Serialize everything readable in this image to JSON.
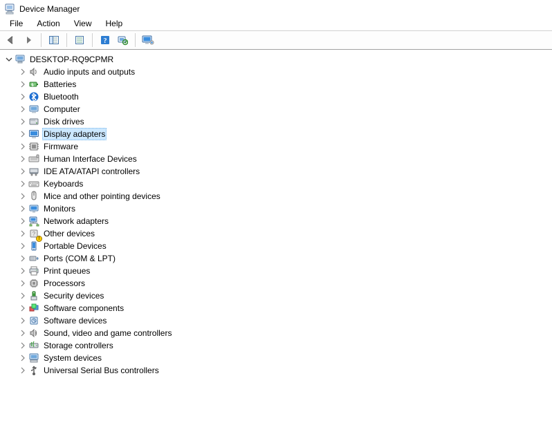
{
  "window": {
    "title": "Device Manager"
  },
  "menu": {
    "items": [
      {
        "label": "File"
      },
      {
        "label": "Action"
      },
      {
        "label": "View"
      },
      {
        "label": "Help"
      }
    ]
  },
  "toolbar": {
    "buttons": [
      {
        "id": "back",
        "name": "back-button",
        "icon": "arrow-left-icon"
      },
      {
        "id": "forward",
        "name": "forward-button",
        "icon": "arrow-right-icon"
      },
      {
        "sep": true
      },
      {
        "id": "console",
        "name": "show-hide-console-tree-button",
        "icon": "console-tree-icon"
      },
      {
        "sep": true
      },
      {
        "id": "props",
        "name": "properties-button",
        "icon": "properties-icon"
      },
      {
        "sep": true
      },
      {
        "id": "help",
        "name": "help-button",
        "icon": "help-icon"
      },
      {
        "id": "scan",
        "name": "scan-hardware-button",
        "icon": "scan-icon"
      },
      {
        "sep": true
      },
      {
        "id": "monitor",
        "name": "devices-button",
        "icon": "monitor-icon"
      }
    ]
  },
  "tree": {
    "root": {
      "label": "DESKTOP-RQ9CPMR",
      "expanded": true,
      "icon": "computer-icon"
    },
    "categories": [
      {
        "label": "Audio inputs and outputs",
        "icon": "speaker-icon"
      },
      {
        "label": "Batteries",
        "icon": "battery-icon"
      },
      {
        "label": "Bluetooth",
        "icon": "bluetooth-icon"
      },
      {
        "label": "Computer",
        "icon": "computer-small-icon"
      },
      {
        "label": "Disk drives",
        "icon": "disk-icon"
      },
      {
        "label": "Display adapters",
        "icon": "display-icon",
        "selected": true
      },
      {
        "label": "Firmware",
        "icon": "firmware-icon"
      },
      {
        "label": "Human Interface Devices",
        "icon": "hid-icon"
      },
      {
        "label": "IDE ATA/ATAPI controllers",
        "icon": "ide-icon"
      },
      {
        "label": "Keyboards",
        "icon": "keyboard-icon"
      },
      {
        "label": "Mice and other pointing devices",
        "icon": "mouse-icon"
      },
      {
        "label": "Monitors",
        "icon": "monitor-small-icon"
      },
      {
        "label": "Network adapters",
        "icon": "network-icon"
      },
      {
        "label": "Other devices",
        "icon": "other-icon",
        "warn": true
      },
      {
        "label": "Portable Devices",
        "icon": "portable-icon"
      },
      {
        "label": "Ports (COM & LPT)",
        "icon": "port-icon"
      },
      {
        "label": "Print queues",
        "icon": "printer-icon"
      },
      {
        "label": "Processors",
        "icon": "cpu-icon"
      },
      {
        "label": "Security devices",
        "icon": "security-icon"
      },
      {
        "label": "Software components",
        "icon": "sw-components-icon"
      },
      {
        "label": "Software devices",
        "icon": "sw-devices-icon"
      },
      {
        "label": "Sound, video and game controllers",
        "icon": "sound-icon"
      },
      {
        "label": "Storage controllers",
        "icon": "storage-icon"
      },
      {
        "label": "System devices",
        "icon": "system-icon"
      },
      {
        "label": "Universal Serial Bus controllers",
        "icon": "usb-icon"
      }
    ]
  }
}
